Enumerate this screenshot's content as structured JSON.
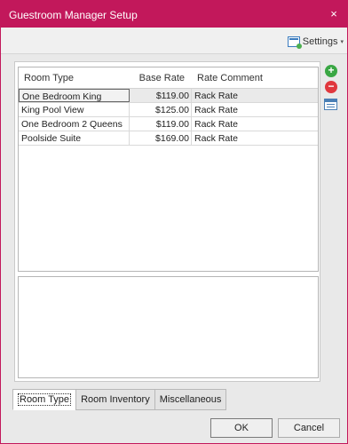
{
  "window": {
    "title": "Guestroom Manager Setup",
    "close_glyph": "×",
    "accent_color": "#c2185b"
  },
  "toolbar": {
    "settings_label": "Settings",
    "settings_icon": "settings-icon",
    "caret": "▾"
  },
  "grid": {
    "columns": [
      "Room Type",
      "Base Rate",
      "Rate Comment"
    ],
    "rows": [
      {
        "room_type": "One Bedroom King",
        "base_rate": "$119.00",
        "rate_comment": "Rack Rate"
      },
      {
        "room_type": "King Pool View",
        "base_rate": "$125.00",
        "rate_comment": "Rack Rate"
      },
      {
        "room_type": "One Bedroom 2 Queens",
        "base_rate": "$119.00",
        "rate_comment": "Rack Rate"
      },
      {
        "room_type": "Poolside Suite",
        "base_rate": "$169.00",
        "rate_comment": "Rack Rate"
      }
    ],
    "selected_row": 0
  },
  "side_tools": {
    "add_glyph": "+",
    "remove_glyph": "−"
  },
  "tabs": [
    {
      "label": "Room Type",
      "active": true
    },
    {
      "label": "Room Inventory",
      "active": false
    },
    {
      "label": "Miscellaneous",
      "active": false
    }
  ],
  "buttons": {
    "ok_label": "OK",
    "cancel_label": "Cancel"
  }
}
